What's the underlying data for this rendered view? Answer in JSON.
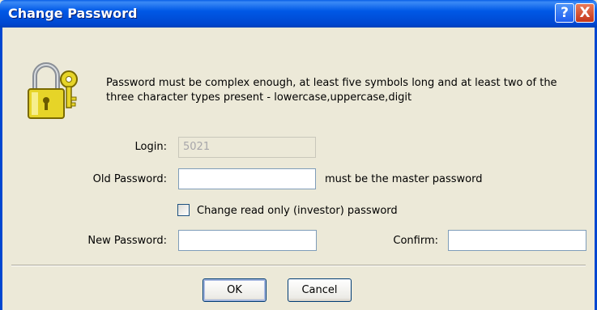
{
  "window": {
    "title": "Change Password",
    "help_label": "?",
    "close_label": "X"
  },
  "message": "Password must be complex enough, at least five symbols long and at least two of the three character types present - lowercase,uppercase,digit",
  "login": {
    "label": "Login:",
    "value": "5021"
  },
  "old_password": {
    "label": "Old Password:",
    "value": "",
    "hint": "must be the master password"
  },
  "investor_checkbox": {
    "label": "Change read only (investor) password",
    "checked": false
  },
  "new_password": {
    "label": "New Password:",
    "value": ""
  },
  "confirm": {
    "label": "Confirm:",
    "value": ""
  },
  "buttons": {
    "ok": "OK",
    "cancel": "Cancel"
  },
  "colors": {
    "titlebar": "#0054e3",
    "dialog_bg": "#ece9d8",
    "accent_gold": "#e6d428"
  },
  "icons": {
    "lock": "lock-keys-icon",
    "help": "help-icon",
    "close": "close-icon"
  }
}
